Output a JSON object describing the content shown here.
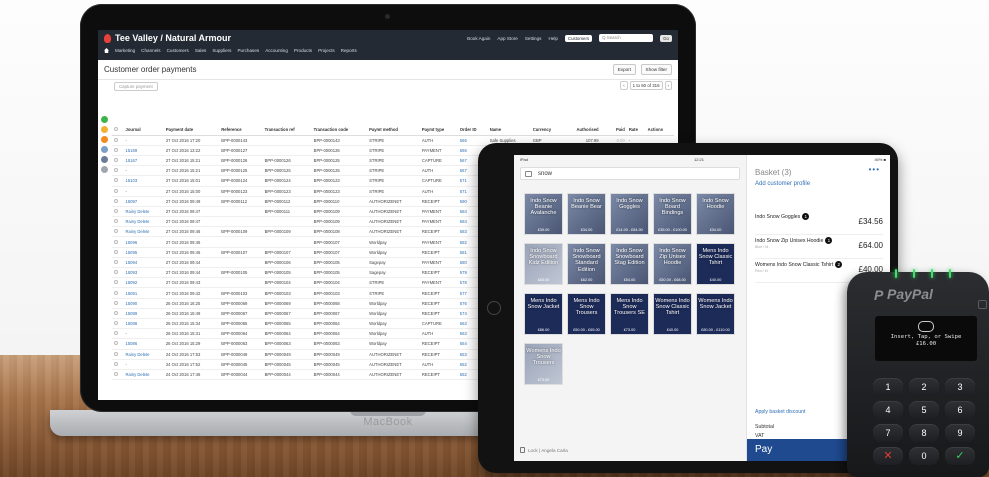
{
  "macbook": {
    "brand": "MacBook",
    "app": {
      "title": "Tee Valley / Natural Armour",
      "menu": [
        "Marketing",
        "Channels",
        "Customers",
        "Sales",
        "Suppliers",
        "Purchases",
        "Accounting",
        "Products",
        "Projects",
        "Reports"
      ],
      "right_nav": [
        "Book Again",
        "App Store",
        "Settings",
        "Help"
      ],
      "customers_label": "Customers",
      "search_placeholder": "Q Search",
      "go_label": "Go",
      "page_title": "Customer order payments",
      "export_label": "Export",
      "show_filter_label": "Show filter",
      "capture_label": "Capture payment",
      "pager_text": "1 to 50 of 316",
      "columns": [
        "Journal",
        "Payment date",
        "Reference",
        "Transaction ref",
        "Transaction code",
        "Paymt method",
        "Paymt type",
        "Order ID",
        "Name",
        "Currency",
        "Authorised",
        "Paid",
        "Rate",
        "Actions"
      ],
      "rows": [
        [
          "-",
          "27 Oct 2016 17:20",
          "BPP-0000143",
          "",
          "BPP-0000143",
          "STRIPE",
          "AUTH",
          "566",
          "Safe Supplies",
          "GBP",
          "107.99",
          "0.00",
          "-",
          ""
        ],
        [
          "15169",
          "27 Oct 2016 13:22",
          "BPP-0000127",
          "",
          "BPP-0000126",
          "STRIPE",
          "PAYMENT",
          "566",
          "Safe Supplies",
          "GBP",
          "0.00",
          "-107.99",
          "-",
          "Reverse"
        ],
        [
          "15167",
          "27 Oct 2016 15:21",
          "BPP-0000126",
          "BPP-0000126",
          "BPP-0000125",
          "STRIPE",
          "CAPTURE",
          "567",
          "Safe Supplies",
          "GBP",
          "0.00",
          "107.99",
          "-",
          ""
        ],
        [
          "-",
          "27 Oct 2016 15:21",
          "BPP-0000125",
          "BPP-0000125",
          "BPP-0000125",
          "STRIPE",
          "AUTH",
          "567",
          "Safe Supplies",
          "GBP",
          "107.99",
          "0.00",
          "-",
          ""
        ],
        [
          "15103",
          "27 Oct 2016 15:01",
          "BPP-0000124",
          "BPP-0000124",
          "BPP-0000123",
          "STRIPE",
          "CAPTURE",
          "571",
          "",
          "",
          "",
          "",
          "",
          ""
        ],
        [
          "-",
          "27 Oct 2016 15:00",
          "BPP-0000123",
          "BPP-0000123",
          "BPP-0000123",
          "STRIPE",
          "AUTH",
          "571",
          "",
          "",
          "",
          "",
          "",
          ""
        ],
        [
          "15097",
          "27 Oct 2016 09:49",
          "BPP-0000112",
          "BPP-0000112",
          "BPP-0000110",
          "AUTHORIZENET",
          "RECEIPT",
          "590",
          "",
          "",
          "",
          "",
          "",
          ""
        ],
        [
          "Rainy Delete",
          "27 Oct 2016 09:47",
          "",
          "BPP-0000111",
          "BPP-0000109",
          "AUTHORIZENET",
          "PAYMENT",
          "584",
          "",
          "",
          "",
          "",
          "",
          ""
        ],
        [
          "Rainy Delete",
          "27 Oct 2016 09:47",
          "",
          "",
          "BPP-0000109",
          "AUTHORIZENET",
          "PAYMENT",
          "584",
          "",
          "",
          "",
          "",
          "",
          ""
        ],
        [
          "Rainy Delete",
          "27 Oct 2016 09:46",
          "BPP-0000109",
          "BPP-0000109",
          "BPP-0000108",
          "AUTHORIZENET",
          "RECEIPT",
          "583",
          "",
          "",
          "",
          "",
          "",
          ""
        ],
        [
          "15096",
          "27 Oct 2016 09:45",
          "",
          "",
          "BPP-0000107",
          "Worldpay",
          "PAYMENT",
          "582",
          "",
          "",
          "",
          "",
          "",
          ""
        ],
        [
          "15095",
          "27 Oct 2016 09:45",
          "BPP-0000107",
          "BPP-0000107",
          "BPP-0000107",
          "Worldpay",
          "RECEIPT",
          "581",
          "",
          "",
          "",
          "",
          "",
          ""
        ],
        [
          "15094",
          "27 Oct 2016 09:44",
          "",
          "BPP-0000106",
          "BPP-0000105",
          "Sagepay",
          "PAYMENT",
          "580",
          "",
          "",
          "",
          "",
          "",
          ""
        ],
        [
          "15093",
          "27 Oct 2016 09:44",
          "BPP-0000105",
          "BPP-0000105",
          "BPP-0000105",
          "Sagepay",
          "RECEIPT",
          "579",
          "",
          "",
          "",
          "",
          "",
          ""
        ],
        [
          "15092",
          "27 Oct 2016 09:43",
          "",
          "BPP-0000104",
          "BPP-0000104",
          "STRIPE",
          "PAYMENT",
          "578",
          "",
          "",
          "",
          "",
          "",
          ""
        ],
        [
          "15091",
          "27 Oct 2016 09:42",
          "BPP-0000103",
          "BPP-0000103",
          "BPP-0000103",
          "STRIPE",
          "RECEIPT",
          "577",
          "",
          "",
          "",
          "",
          "",
          ""
        ],
        [
          "15090",
          "26 Oct 2016 16:25",
          "BPP-0000069",
          "BPP-0000069",
          "BPP-0000068",
          "Worldpay",
          "RECEIPT",
          "576",
          "",
          "",
          "",
          "",
          "",
          ""
        ],
        [
          "15089",
          "26 Oct 2016 15:49",
          "BPP-0000067",
          "BPP-0000067",
          "BPP-0000067",
          "Worldpay",
          "RECEIPT",
          "574",
          "",
          "",
          "",
          "",
          "",
          ""
        ],
        [
          "15088",
          "26 Oct 2016 15:34",
          "BPP-0000065",
          "BPP-0000065",
          "BPP-0000064",
          "Worldpay",
          "CAPTURE",
          "563",
          "",
          "",
          "",
          "",
          "",
          ""
        ],
        [
          "-",
          "26 Oct 2016 15:31",
          "BPP-0000064",
          "BPP-0000064",
          "BPP-0000064",
          "Worldpay",
          "AUTH",
          "563",
          "",
          "",
          "",
          "",
          "",
          ""
        ],
        [
          "15086",
          "26 Oct 2016 15:29",
          "BPP-0000063",
          "BPP-0000063",
          "BPP-0000063",
          "Worldpay",
          "RECEIPT",
          "564",
          "",
          "",
          "",
          "",
          "",
          ""
        ],
        [
          "Rainy Delete",
          "24 Oct 2016 17:53",
          "BPP-0000049",
          "BPP-0000049",
          "BPP-0000049",
          "AUTHORIZENET",
          "RECEIPT",
          "553",
          "",
          "",
          "",
          "",
          "",
          ""
        ],
        [
          "-",
          "24 Oct 2016 17:52",
          "BPP-0000045",
          "BPP-0000045",
          "BPP-0000045",
          "AUTHORIZENET",
          "AUTH",
          "552",
          "",
          "",
          "",
          "",
          "",
          ""
        ],
        [
          "Rainy Delete",
          "24 Oct 2016 17:46",
          "BPP-0000044",
          "BPP-0000044",
          "BPP-0000044",
          "AUTHORIZENET",
          "RECEIPT",
          "552",
          "",
          "",
          "",
          "",
          "",
          ""
        ]
      ]
    }
  },
  "ipad": {
    "status_left": "iPad",
    "status_center": "12:21",
    "status_right": "40% ■",
    "search_value": "snow",
    "tiles": [
      {
        "label": "Indo Snow Beanie Avalanche",
        "price": "£39.00",
        "style": ""
      },
      {
        "label": "Indo Snow Beanie Bear",
        "price": "£34.00",
        "style": ""
      },
      {
        "label": "Indo Snow Goggles",
        "price": "£14.00 - £84.00",
        "style": ""
      },
      {
        "label": "Indo Snow Board Bindings",
        "price": "£35.00 - £100.00",
        "style": ""
      },
      {
        "label": "Indo Snow Hoodie",
        "price": "£34.00",
        "style": ""
      },
      {
        "label": "Indo Snow Snowboard Kidz Edition",
        "price": "£83.00",
        "style": "grey"
      },
      {
        "label": "Indo Snow Snowboard Standard Edition",
        "price": "£62.00",
        "style": ""
      },
      {
        "label": "Indo Snow Snowboard Stag Edition",
        "price": "£54.00",
        "style": ""
      },
      {
        "label": "Indo Snow Zip Unisex Hoodie",
        "price": "£50.00 - £68.00",
        "style": ""
      },
      {
        "label": "Mens Indo Snow Classic Tshirt",
        "price": "£40.00",
        "style": "navy"
      },
      {
        "label": "Mens Indo Snow Jacket",
        "price": "£86.00",
        "style": "navy"
      },
      {
        "label": "Mens Indo Snow Trousers",
        "price": "£50.00 - £65.00",
        "style": "navy"
      },
      {
        "label": "Mens Indo Snow Trousers SE",
        "price": "£73.00",
        "style": "navy"
      },
      {
        "label": "Womens Indo Snow Classic Tshirt",
        "price": "£40.00",
        "style": "navy"
      },
      {
        "label": "Womens Indo Snow Jacket",
        "price": "£80.00 - £110.00",
        "style": "navy"
      },
      {
        "label": "Womens Indo Snow Trousers",
        "price": "£73.00",
        "style": "grey"
      }
    ],
    "footer_user": "Lock | Angela Carla",
    "basket": {
      "title": "Basket (3)",
      "dots": "•••",
      "add_customer": "Add customer profile",
      "items": [
        {
          "name": "Indo Snow Goggles",
          "qty": "1",
          "price": "£34.56",
          "sub": ""
        },
        {
          "name": "Indo Snow Zip Unisex Hoodie",
          "qty": "1",
          "price": "£64.00",
          "sub": "Blue / M"
        },
        {
          "name": "Womens Indo Snow Classic Tshirt",
          "qty": "2",
          "price": "£40.00",
          "sub": "Red / M"
        }
      ],
      "discount_label": "Apply basket discount",
      "subtotal_label": "Subtotal",
      "vat_label": "VAT",
      "pay_label": "Pay",
      "pay_amount": "£1"
    }
  },
  "reader": {
    "brand": "PayPal",
    "message": "Insert, Tap, or Swipe",
    "amount": "£16.00",
    "keys": [
      "1",
      "2",
      "3",
      "4",
      "5",
      "6",
      "7",
      "8",
      "9",
      "✕",
      "0",
      "✓"
    ],
    "yellow_key": "←"
  },
  "colors": {
    "accent": "#2f6fb4",
    "nav": "#232a34",
    "pay": "#1f4a8f",
    "paypal_led": "#3ee06a"
  }
}
